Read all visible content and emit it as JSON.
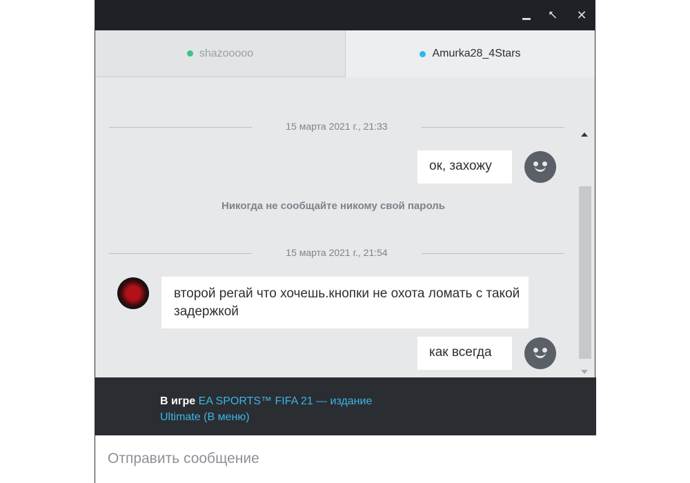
{
  "window": {
    "controls": {
      "minimize_icon": "minimize-icon",
      "restore_icon": "restore-icon",
      "close_icon": "close-icon",
      "restore_glyph": "⭦",
      "close_glyph": "✕"
    }
  },
  "tabs": [
    {
      "name": "shazooooo",
      "status_color": "#39c48a",
      "active": false
    },
    {
      "name": "Amurka28_4Stars",
      "status_color": "#2bb8ef",
      "active": true
    }
  ],
  "messages": {
    "date_1": "15 марта 2021 г., 21:33",
    "own_1": "ок, захожу",
    "notice": "Никогда не сообщайте никому свой пароль",
    "date_2": "15 марта 2021 г., 21:54",
    "other_1": "второй регай что хочешь.кнопки не охота ломать с такой задержкой",
    "own_2": "как всегда"
  },
  "ingame": {
    "label": "В игре",
    "game": "EA SPORTS™ FIFA 21 — издание Ultimate (В меню)"
  },
  "composer": {
    "placeholder": "Отправить сообщение",
    "value": ""
  },
  "colors": {
    "accent": "#3db5ea",
    "titlebar": "#1e2226",
    "chat_bg": "#e6e8ea"
  }
}
